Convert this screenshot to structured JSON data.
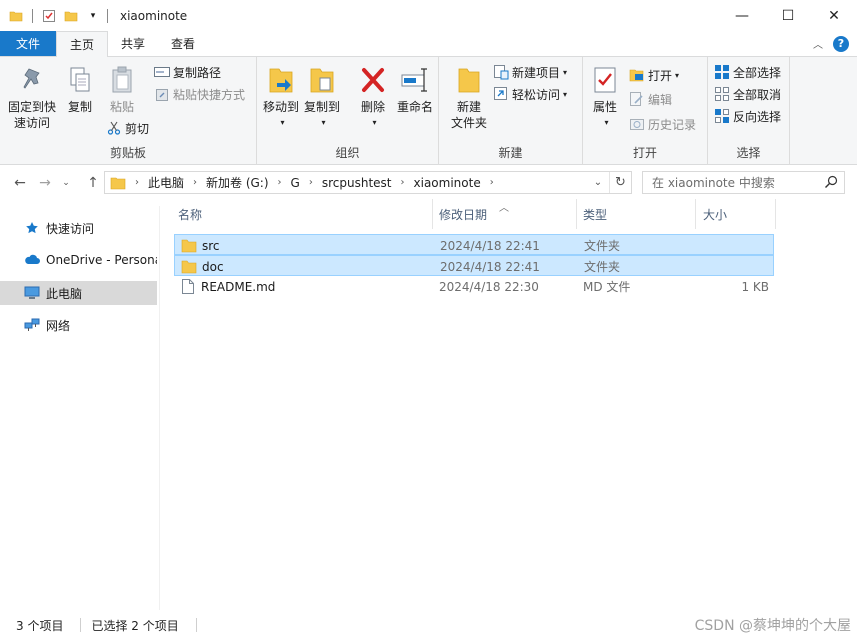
{
  "window": {
    "title": "xiaominote",
    "minimize": "—",
    "maximize": "☐",
    "close": "✕"
  },
  "ribbon_tabs": [
    {
      "label": "文件"
    },
    {
      "label": "主页"
    },
    {
      "label": "共享"
    },
    {
      "label": "查看"
    }
  ],
  "ribbon": {
    "clipboard": {
      "pin_label": "固定到快\n速访问",
      "copy_label": "复制",
      "paste_label": "粘贴",
      "copy_path_label": "复制路径",
      "paste_shortcut_label": "粘贴快捷方式",
      "cut_label": "剪切",
      "group_label": "剪贴板"
    },
    "organize": {
      "move_to_label": "移动到",
      "copy_to_label": "复制到",
      "delete_label": "删除",
      "rename_label": "重命名",
      "group_label": "组织"
    },
    "new": {
      "new_folder_label": "新建\n文件夹",
      "new_item_label": "新建项目",
      "easy_access_label": "轻松访问",
      "group_label": "新建"
    },
    "open": {
      "properties_label": "属性",
      "open_label": "打开",
      "edit_label": "编辑",
      "history_label": "历史记录",
      "group_label": "打开"
    },
    "select": {
      "select_all_label": "全部选择",
      "select_none_label": "全部取消",
      "invert_label": "反向选择",
      "group_label": "选择"
    }
  },
  "address": {
    "crumbs": [
      "此电脑",
      "新加卷 (G:)",
      "G",
      "srcpushtest",
      "xiaominote"
    ]
  },
  "search": {
    "placeholder": "在 xiaominote 中搜索"
  },
  "sidebar": {
    "items": [
      {
        "label": "快速访问"
      },
      {
        "label": "OneDrive - Persona"
      },
      {
        "label": "此电脑"
      },
      {
        "label": "网络"
      }
    ]
  },
  "columns": {
    "name": "名称",
    "date": "修改日期",
    "type": "类型",
    "size": "大小"
  },
  "files": [
    {
      "name": "src",
      "date": "2024/4/18 22:41",
      "type": "文件夹",
      "size": ""
    },
    {
      "name": "doc",
      "date": "2024/4/18 22:41",
      "type": "文件夹",
      "size": ""
    },
    {
      "name": "README.md",
      "date": "2024/4/18 22:30",
      "type": "MD 文件",
      "size": "1 KB"
    }
  ],
  "status": {
    "count": "3 个项目",
    "selected": "已选择 2 个项目"
  },
  "watermark": "CSDN @蔡坤坤的个大屋",
  "colors": {
    "accent": "#1979ca",
    "selection_bg": "#cce8ff",
    "selection_border": "#99d1ff",
    "folder": "#f5c74a"
  }
}
